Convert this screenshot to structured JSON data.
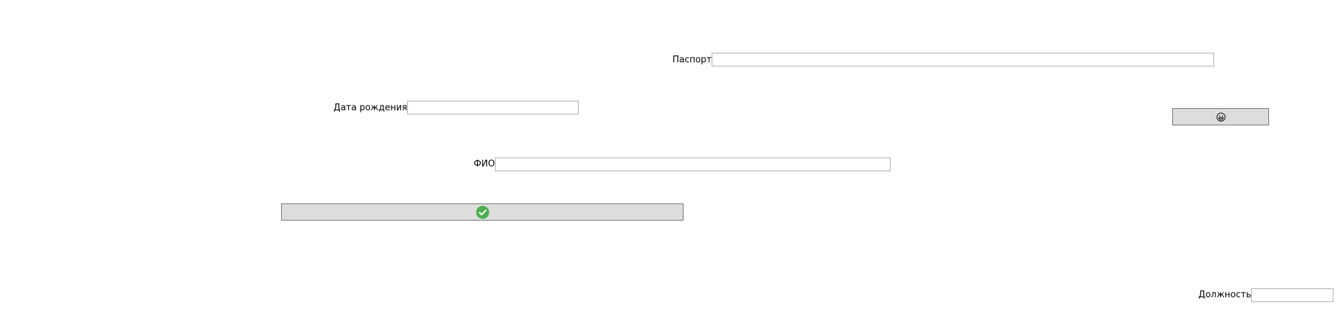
{
  "form": {
    "passport": {
      "label": "Паспорт",
      "value": "",
      "placeholder": ""
    },
    "birth_date": {
      "label": "Дата рождения",
      "value": "",
      "placeholder": ""
    },
    "full_name": {
      "label": "ФИО",
      "value": "",
      "placeholder": ""
    },
    "position": {
      "label": "Должность",
      "value": "",
      "placeholder": ""
    }
  },
  "buttons": {
    "confirm": {
      "icon": "check-circle-icon",
      "icon_color": "#4caf50"
    },
    "secondary": {
      "icon": "smiley-face-icon"
    }
  },
  "colors": {
    "button_background": "#dddddd",
    "button_border": "#707070",
    "input_border": "#acacac"
  }
}
